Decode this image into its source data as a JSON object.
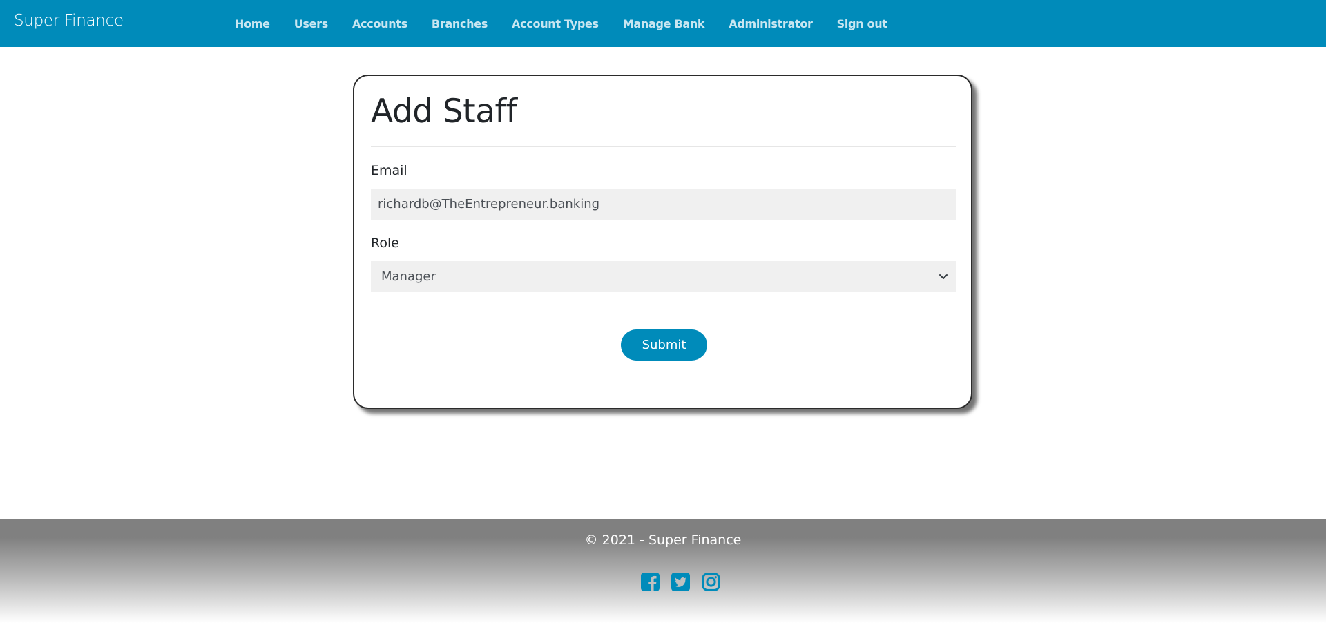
{
  "navbar": {
    "brand": "Super Finance",
    "links": [
      "Home",
      "Users",
      "Accounts",
      "Branches",
      "Account Types",
      "Manage Bank",
      "Administrator",
      "Sign out"
    ],
    "background_color": "#008bba"
  },
  "form": {
    "title": "Add Staff",
    "email": {
      "label": "Email",
      "value": "richardb@TheEntrepreneur.banking"
    },
    "role": {
      "label": "Role",
      "selected": "Manager"
    },
    "submit_label": "Submit",
    "accent_color": "#008bba"
  },
  "footer": {
    "copyright": "© 2021 - Super Finance",
    "socials": [
      {
        "icon": "facebook-icon",
        "label": "Facebook"
      },
      {
        "icon": "twitter-icon",
        "label": "Twitter"
      },
      {
        "icon": "instagram-icon",
        "label": "Instagram"
      }
    ]
  }
}
